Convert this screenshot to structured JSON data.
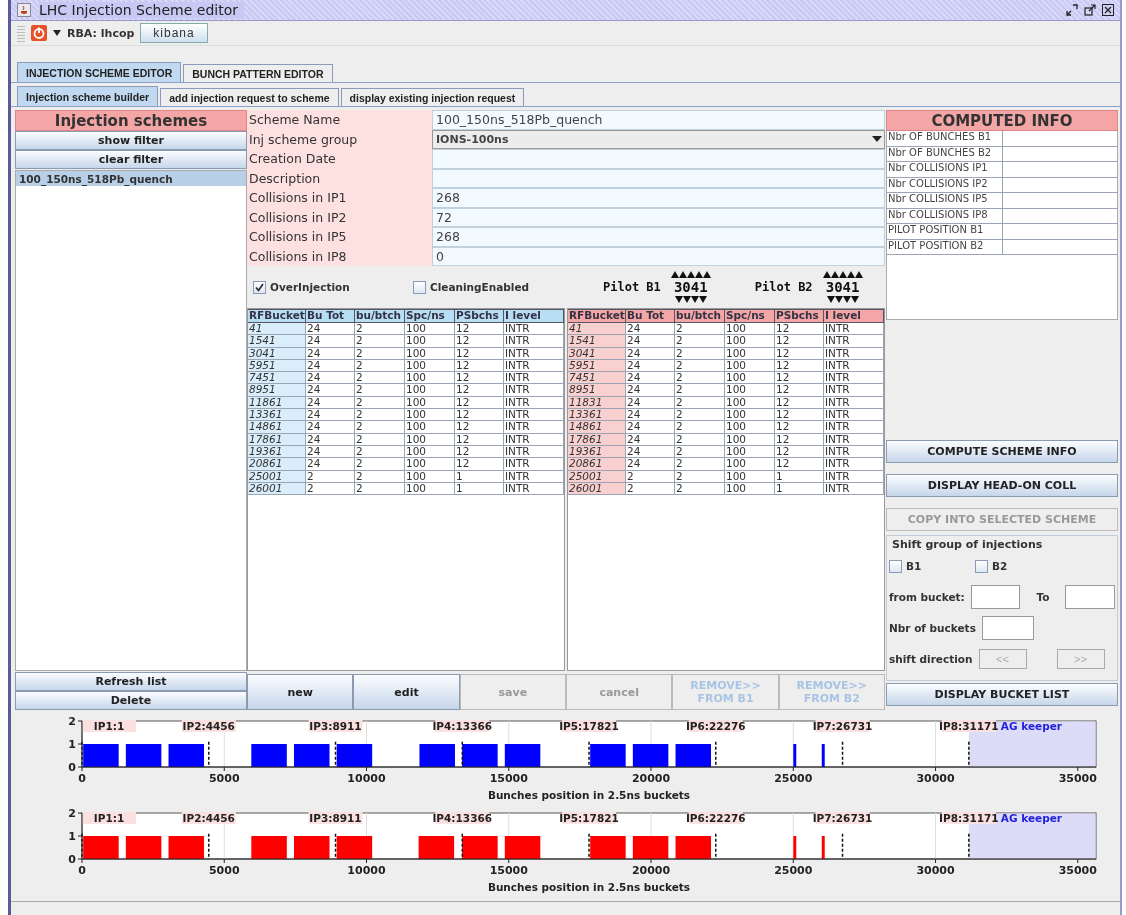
{
  "window": {
    "title": "LHC Injection Scheme editor"
  },
  "toolbar": {
    "rba_label": "RBA: lhcop",
    "kibana_label": "kibana"
  },
  "main_tabs": [
    {
      "label": "INJECTION SCHEME EDITOR",
      "selected": true
    },
    {
      "label": "BUNCH PATTERN EDITOR",
      "selected": false
    }
  ],
  "sub_tabs": [
    {
      "label": "Injection scheme builder",
      "selected": true
    },
    {
      "label": "add injection request to scheme",
      "selected": false
    },
    {
      "label": "display existing injection request",
      "selected": false
    }
  ],
  "schemes_panel": {
    "title": "Injection schemes",
    "top_buttons": [
      "show filter",
      "clear filter"
    ],
    "items": [
      {
        "label": "100_150ns_518Pb_quench",
        "selected": true
      }
    ],
    "bottom_buttons": [
      "Refresh list",
      "Delete"
    ]
  },
  "form": {
    "fields": [
      {
        "label": "Scheme Name",
        "kind": "text",
        "value": "100_150ns_518Pb_quench"
      },
      {
        "label": "Inj scheme group",
        "kind": "combo",
        "value": "IONS-100ns"
      },
      {
        "label": "Creation Date",
        "kind": "text"
      },
      {
        "label": "Description",
        "kind": "text"
      },
      {
        "label": "Collisions in IP1",
        "kind": "text",
        "value": "268"
      },
      {
        "label": "Collisions in IP2",
        "kind": "text",
        "value": "72"
      },
      {
        "label": "Collisions in IP5",
        "kind": "text",
        "value": "268"
      },
      {
        "label": "Collisions in IP8",
        "kind": "text",
        "value": "0"
      }
    ]
  },
  "options": [
    {
      "label": "OverInjection",
      "checked": true
    },
    {
      "label": "CleaningEnabled",
      "checked": false
    }
  ],
  "pilots": [
    {
      "label": "Pilot B1",
      "value": "3041"
    },
    {
      "label": "Pilot B2",
      "value": "3041"
    }
  ],
  "tables": [
    {
      "color": "#b8def6",
      "columns": [
        "RFBucket",
        "Bu Tot",
        "bu/btch",
        "Spc/ns",
        "PSbchs",
        "I level"
      ],
      "rows": [
        [
          "41",
          "24",
          "2",
          "100",
          "12",
          "INTR"
        ],
        [
          "1541",
          "24",
          "2",
          "100",
          "12",
          "INTR"
        ],
        [
          "3041",
          "24",
          "2",
          "100",
          "12",
          "INTR"
        ],
        [
          "5951",
          "24",
          "2",
          "100",
          "12",
          "INTR"
        ],
        [
          "7451",
          "24",
          "2",
          "100",
          "12",
          "INTR"
        ],
        [
          "8951",
          "24",
          "2",
          "100",
          "12",
          "INTR"
        ],
        [
          "11861",
          "24",
          "2",
          "100",
          "12",
          "INTR"
        ],
        [
          "13361",
          "24",
          "2",
          "100",
          "12",
          "INTR"
        ],
        [
          "14861",
          "24",
          "2",
          "100",
          "12",
          "INTR"
        ],
        [
          "17861",
          "24",
          "2",
          "100",
          "12",
          "INTR"
        ],
        [
          "19361",
          "24",
          "2",
          "100",
          "12",
          "INTR"
        ],
        [
          "20861",
          "24",
          "2",
          "100",
          "12",
          "INTR"
        ],
        [
          "25001",
          "2",
          "2",
          "100",
          "1",
          "INTR"
        ],
        [
          "26001",
          "2",
          "2",
          "100",
          "1",
          "INTR"
        ]
      ]
    },
    {
      "color": "#f4a6a6",
      "columns": [
        "RFBucket",
        "Bu Tot",
        "bu/btch",
        "Spc/ns",
        "PSbchs",
        "I level"
      ],
      "rows": [
        [
          "41",
          "24",
          "2",
          "100",
          "12",
          "INTR"
        ],
        [
          "1541",
          "24",
          "2",
          "100",
          "12",
          "INTR"
        ],
        [
          "3041",
          "24",
          "2",
          "100",
          "12",
          "INTR"
        ],
        [
          "5951",
          "24",
          "2",
          "100",
          "12",
          "INTR"
        ],
        [
          "7451",
          "24",
          "2",
          "100",
          "12",
          "INTR"
        ],
        [
          "8951",
          "24",
          "2",
          "100",
          "12",
          "INTR"
        ],
        [
          "11831",
          "24",
          "2",
          "100",
          "12",
          "INTR"
        ],
        [
          "13361",
          "24",
          "2",
          "100",
          "12",
          "INTR"
        ],
        [
          "14861",
          "24",
          "2",
          "100",
          "12",
          "INTR"
        ],
        [
          "17861",
          "24",
          "2",
          "100",
          "12",
          "INTR"
        ],
        [
          "19361",
          "24",
          "2",
          "100",
          "12",
          "INTR"
        ],
        [
          "20861",
          "24",
          "2",
          "100",
          "12",
          "INTR"
        ],
        [
          "25001",
          "2",
          "2",
          "100",
          "1",
          "INTR"
        ],
        [
          "26001",
          "2",
          "2",
          "100",
          "1",
          "INTR"
        ]
      ]
    }
  ],
  "action_buttons": [
    {
      "label": "new",
      "disabled": false
    },
    {
      "label": "edit",
      "disabled": false
    },
    {
      "label": "save",
      "disabled": true
    },
    {
      "label": "cancel",
      "disabled": true
    },
    {
      "label": "REMOVE>>\nFROM B1",
      "disabled": true
    },
    {
      "label": "REMOVE>>\nFROM B2",
      "disabled": true
    }
  ],
  "computed_info": {
    "title": "COMPUTED INFO",
    "rows": [
      "Nbr OF BUNCHES B1",
      "Nbr OF BUNCHES B2",
      "Nbr COLLISIONS IP1",
      "Nbr COLLISIONS IP2",
      "Nbr COLLISIONS IP5",
      "Nbr COLLISIONS IP8",
      "PILOT POSITION B1",
      "PILOT POSITION B2"
    ]
  },
  "right_buttons": [
    {
      "label": "COMPUTE SCHEME INFO",
      "disabled": false
    },
    {
      "label": "DISPLAY HEAD-ON COLL",
      "disabled": false
    },
    {
      "label": "COPY INTO SELECTED SCHEME",
      "disabled": true
    }
  ],
  "shift_group": {
    "title": "Shift group of injections",
    "beams": [
      {
        "label": "B1",
        "checked": false
      },
      {
        "label": "B2",
        "checked": false
      }
    ],
    "from_label": "from bucket:",
    "to_label": "To",
    "count_label": "Nbr of buckets",
    "direction_label": "shift direction",
    "direction_buttons": [
      {
        "label": "<<",
        "disabled": true
      },
      {
        "label": ">>",
        "disabled": true
      }
    ]
  },
  "bucket_list_button": {
    "label": "DISPLAY BUCKET LIST"
  },
  "charts": [
    {
      "chart_data": {
        "type": "bar",
        "xlabel": "Bunches position in 2.5ns buckets",
        "xlim": [
          0,
          35640
        ],
        "ylim": [
          0,
          2
        ],
        "xticks": [
          0,
          5000,
          10000,
          15000,
          20000,
          25000,
          30000,
          35000
        ],
        "yticks": [
          0,
          1,
          2
        ],
        "grid": true,
        "series": [
          {
            "color": "#0000ff",
            "values": [
              1,
              1,
              1,
              1,
              1,
              1,
              1,
              1,
              1,
              1,
              1,
              1,
              1,
              1
            ]
          }
        ],
        "x": [
          665,
          2165,
          3665,
          6575,
          8075,
          9575,
          12485,
          13985,
          15485,
          18485,
          19985,
          21485,
          25053,
          26053
        ],
        "ref_lines": [
          {
            "axis": "x",
            "value": 1
          },
          {
            "axis": "x",
            "value": 4456
          },
          {
            "axis": "x",
            "value": 8911
          },
          {
            "axis": "x",
            "value": 13366
          },
          {
            "axis": "x",
            "value": 17821
          },
          {
            "axis": "x",
            "value": 22276
          },
          {
            "axis": "x",
            "value": 26731
          },
          {
            "axis": "x",
            "value": 31171
          }
        ],
        "bands": [
          {
            "axis": "x",
            "from": 31171,
            "to": 35640,
            "color": "#dcdcf8",
            "label": "AG keeper"
          }
        ],
        "annotations": [
          "IP1:1",
          "IP2:4456",
          "IP3:8911",
          "IP4:13366",
          "IP5:17821",
          "IP6:22276",
          "IP7:26731",
          "IP8:31171"
        ]
      }
    },
    {
      "chart_data": {
        "type": "bar",
        "xlabel": "Bunches position in 2.5ns buckets",
        "xlim": [
          0,
          35640
        ],
        "ylim": [
          0,
          2
        ],
        "xticks": [
          0,
          5000,
          10000,
          15000,
          20000,
          25000,
          30000,
          35000
        ],
        "yticks": [
          0,
          1,
          2
        ],
        "grid": true,
        "series": [
          {
            "color": "#ff0000",
            "values": [
              1,
              1,
              1,
              1,
              1,
              1,
              1,
              1,
              1,
              1,
              1,
              1,
              1,
              1
            ]
          }
        ],
        "x": [
          665,
          2165,
          3665,
          6575,
          8075,
          9575,
          12455,
          13985,
          15485,
          18485,
          19985,
          21485,
          25053,
          26053
        ],
        "ref_lines": [
          {
            "axis": "x",
            "value": 1
          },
          {
            "axis": "x",
            "value": 4456
          },
          {
            "axis": "x",
            "value": 8911
          },
          {
            "axis": "x",
            "value": 13366
          },
          {
            "axis": "x",
            "value": 17821
          },
          {
            "axis": "x",
            "value": 22276
          },
          {
            "axis": "x",
            "value": 26731
          },
          {
            "axis": "x",
            "value": 31171
          }
        ],
        "bands": [
          {
            "axis": "x",
            "from": 31171,
            "to": 35640,
            "color": "#dcdcf8",
            "label": "AG keeper"
          }
        ],
        "annotations": [
          "IP1:1",
          "IP2:4456",
          "IP3:8911",
          "IP4:13366",
          "IP5:17821",
          "IP6:22276",
          "IP7:26731",
          "IP8:31171"
        ]
      }
    }
  ]
}
